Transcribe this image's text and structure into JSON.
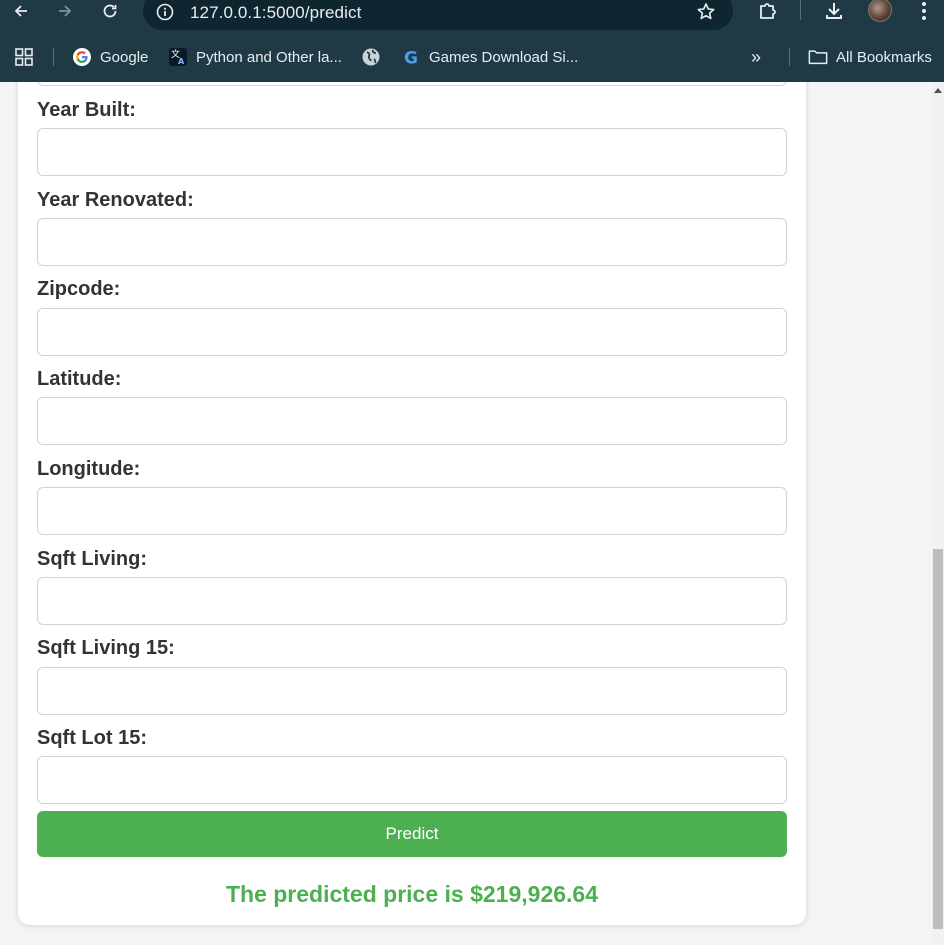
{
  "browser": {
    "url": "127.0.0.1:5000/predict",
    "bookmarks": [
      {
        "label": "Google"
      },
      {
        "label": "Python and Other la..."
      },
      {
        "label": ""
      },
      {
        "label": "Games Download Si..."
      }
    ],
    "overflow_label": "»",
    "all_bookmarks_label": "All Bookmarks"
  },
  "form": {
    "fields": [
      {
        "label": "Year Built:",
        "value": ""
      },
      {
        "label": "Year Renovated:",
        "value": ""
      },
      {
        "label": "Zipcode:",
        "value": ""
      },
      {
        "label": "Latitude:",
        "value": ""
      },
      {
        "label": "Longitude:",
        "value": ""
      },
      {
        "label": "Sqft Living:",
        "value": ""
      },
      {
        "label": "Sqft Living 15:",
        "value": ""
      },
      {
        "label": "Sqft Lot 15:",
        "value": ""
      }
    ],
    "submit_label": "Predict"
  },
  "result": {
    "text": "The predicted price is $219,926.64"
  },
  "colors": {
    "accent": "#4caf50",
    "chrome": "#1f3a45"
  },
  "icons": [
    "back-icon",
    "forward-icon",
    "reload-icon",
    "site-info-icon",
    "bookmark-star-icon",
    "extensions-icon",
    "download-icon",
    "menu-icon",
    "apps-icon",
    "google-icon",
    "translate-icon",
    "globe-icon",
    "folder-icon"
  ]
}
